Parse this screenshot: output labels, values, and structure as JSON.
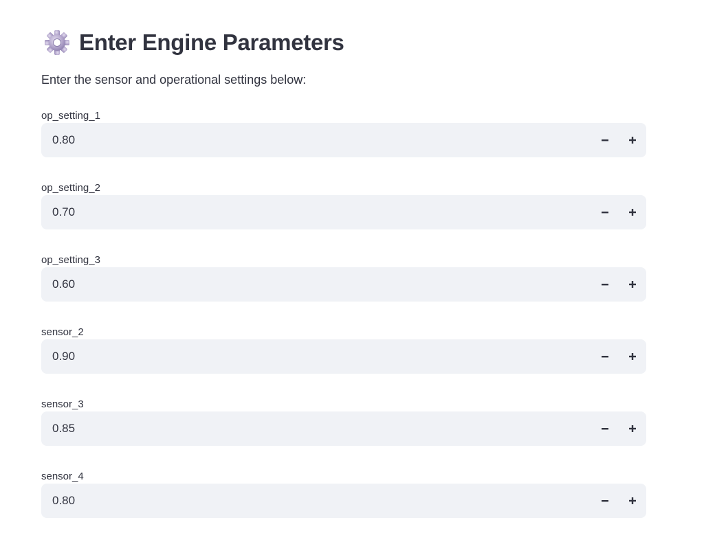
{
  "header": {
    "icon": "gear-icon",
    "title": "Enter Engine Parameters"
  },
  "intro_text": "Enter the sensor and operational settings below:",
  "fields": [
    {
      "label": "op_setting_1",
      "value": "0.80"
    },
    {
      "label": "op_setting_2",
      "value": "0.70"
    },
    {
      "label": "op_setting_3",
      "value": "0.60"
    },
    {
      "label": "sensor_2",
      "value": "0.90"
    },
    {
      "label": "sensor_3",
      "value": "0.85"
    },
    {
      "label": "sensor_4",
      "value": "0.80"
    }
  ],
  "colors": {
    "text": "#31333f",
    "input_bg": "#f0f2f6",
    "icon_accent": "#9b8fb8"
  }
}
